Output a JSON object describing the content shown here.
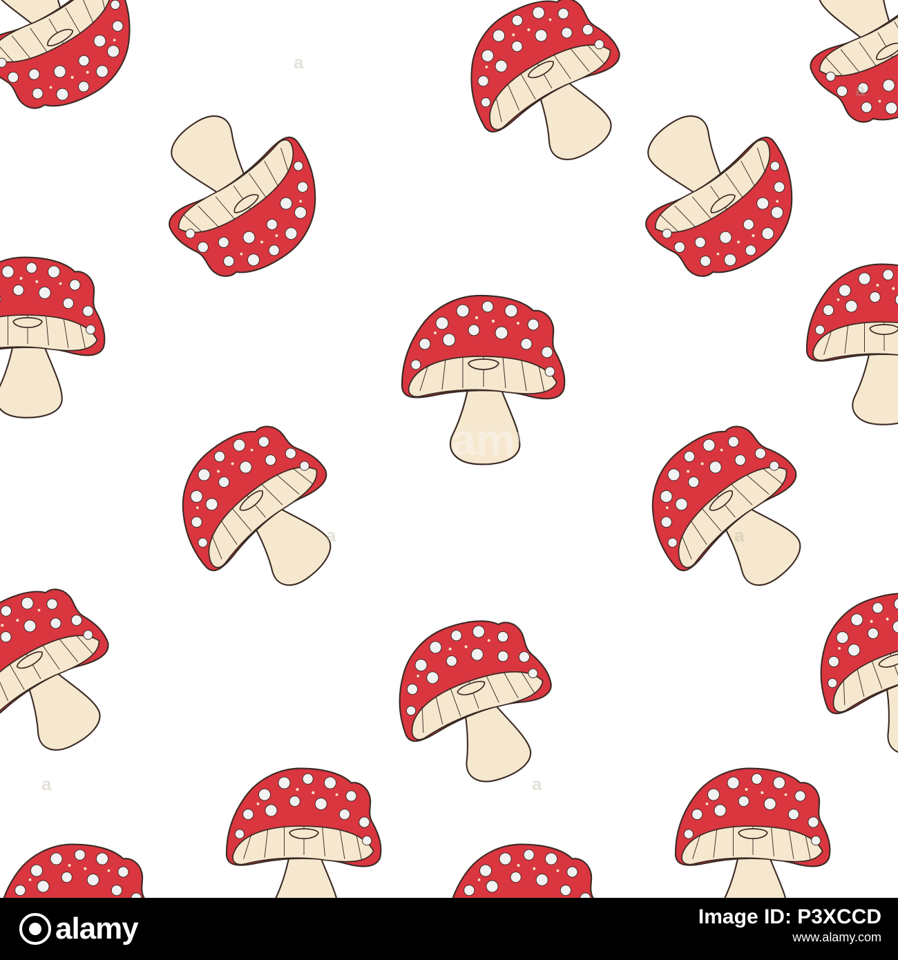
{
  "image": {
    "subject": "seamless-pattern",
    "motif": "fly-agaric-mushroom",
    "colors": {
      "background": "#ffffff",
      "cap_red": "#d93640",
      "cap_dots": "#f2f2f2",
      "cap_inner_dots": "#f4e7cf",
      "stem_cream": "#f6e7cf",
      "outline": "#3a2a24",
      "footer_bg": "#000000"
    }
  },
  "watermark": {
    "text": "alamy",
    "small_marks": [
      "a",
      "a",
      "a",
      "a",
      "a",
      "a"
    ]
  },
  "footer": {
    "logo_text": "alamy",
    "id_label": "Image ID: P3XCCD",
    "url": "www.alamy.com"
  }
}
